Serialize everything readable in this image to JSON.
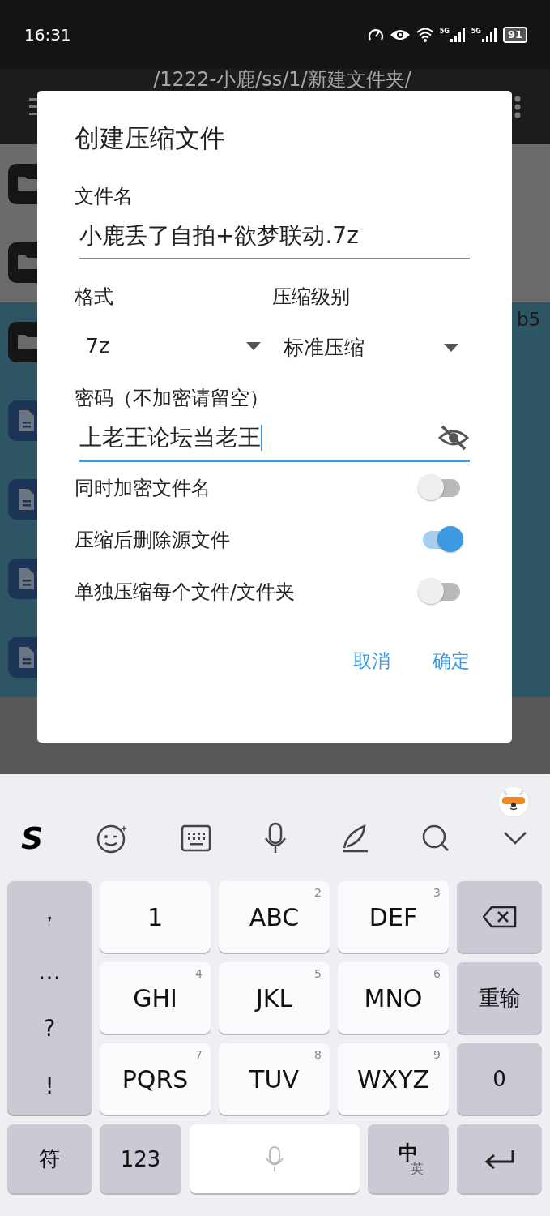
{
  "status_bar": {
    "time": "16:31",
    "sim_labels": [
      "5G",
      "5G"
    ],
    "battery": "91"
  },
  "background": {
    "path_title": "/1222-小鹿/ss/1/新建文件夹/",
    "items": [
      {
        "kind": "folder",
        "selected": false
      },
      {
        "kind": "folder",
        "selected": false
      },
      {
        "kind": "folder",
        "selected": true,
        "trailing": "b5"
      },
      {
        "kind": "file",
        "selected": true
      },
      {
        "kind": "file",
        "selected": true
      },
      {
        "kind": "file",
        "selected": true
      },
      {
        "kind": "file",
        "selected": true
      }
    ]
  },
  "dialog": {
    "title": "创建压缩文件",
    "filename_label": "文件名",
    "filename_value": "小鹿丢了自拍+欲梦联动.7z",
    "format_label": "格式",
    "format_value": "7z",
    "level_label": "压缩级别",
    "level_value": "标准压缩",
    "password_label": "密码（不加密请留空）",
    "password_value": "上老王论坛当老王",
    "password_visible": true,
    "toggles": [
      {
        "label": "同时加密文件名",
        "on": false
      },
      {
        "label": "压缩后删除源文件",
        "on": true
      },
      {
        "label": "单独压缩每个文件/文件夹",
        "on": false
      }
    ],
    "buttons": [
      "取消",
      "确定"
    ]
  },
  "keyboard": {
    "logo": "S",
    "symbols": [
      "，",
      "…",
      "?",
      "!"
    ],
    "keys": [
      {
        "kind": "key",
        "label": "1"
      },
      {
        "kind": "key",
        "label": "ABC",
        "hint": "2"
      },
      {
        "kind": "key",
        "label": "DEF",
        "hint": "3"
      },
      {
        "kind": "backspace"
      },
      {
        "kind": "key",
        "label": "GHI",
        "hint": "4"
      },
      {
        "kind": "key",
        "label": "JKL",
        "hint": "5"
      },
      {
        "kind": "key",
        "label": "MNO",
        "hint": "6"
      },
      {
        "kind": "func",
        "label": "重输"
      },
      {
        "kind": "key",
        "label": "PQRS",
        "hint": "7"
      },
      {
        "kind": "key",
        "label": "TUV",
        "hint": "8"
      },
      {
        "kind": "key",
        "label": "WXYZ",
        "hint": "9"
      },
      {
        "kind": "func",
        "label": "0"
      }
    ],
    "symbol_key": "符",
    "number_key": "123",
    "lang_main": "中",
    "lang_alt": "英"
  }
}
